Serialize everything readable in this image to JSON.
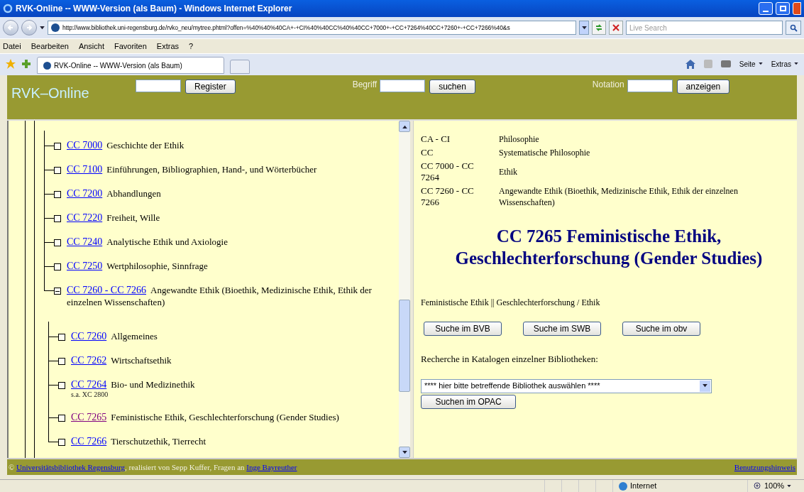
{
  "window": {
    "title": "RVK-Online -- WWW-Version (als Baum) - Windows Internet Explorer"
  },
  "address_bar": {
    "url": "http://www.bibliothek.uni-regensburg.de/rvko_neu/mytree.phtml?offen=%40%40%40CA+-+CI%40%40CC%40%40CC+7000+-+CC+7264%40CC+7260+-+CC+7266%40&s",
    "search_placeholder": "Live Search"
  },
  "menu": [
    "Datei",
    "Bearbeiten",
    "Ansicht",
    "Favoriten",
    "Extras",
    "?"
  ],
  "tabs": [
    {
      "label": "RVK-Online -- WWW-Version (als Baum)",
      "selected": true
    }
  ],
  "toolbar": [
    "Seite",
    "Extras"
  ],
  "header": {
    "logo": "RVK–Online",
    "register_button": "Register",
    "begriff_label": "Begriff",
    "suchen_button": "suchen",
    "notation_label": "Notation",
    "anzeigen_button": "anzeigen"
  },
  "tree": [
    {
      "code": "CC 7000",
      "label": "Geschichte der Ethik",
      "visited": false,
      "expanded": false
    },
    {
      "code": "CC 7100",
      "label": "Einführungen, Bibliographien, Hand-, und Wörterbücher",
      "visited": false,
      "expanded": false
    },
    {
      "code": "CC 7200",
      "label": "Abhandlungen",
      "visited": false,
      "expanded": false
    },
    {
      "code": "CC 7220",
      "label": "Freiheit, Wille",
      "visited": false,
      "expanded": false
    },
    {
      "code": "CC 7240",
      "label": "Analytische Ethik und Axiologie",
      "visited": false,
      "expanded": false
    },
    {
      "code": "CC 7250",
      "label": "Wertphilosophie, Sinnfrage",
      "visited": false,
      "expanded": false
    },
    {
      "code": "CC 7260 - CC 7266",
      "label": "Angewandte Ethik (Bioethik, Medizinische Ethik, Ethik der einzelnen Wissenschaften)",
      "visited": false,
      "expanded": true,
      "children": [
        {
          "code": "CC 7260",
          "label": "Allgemeines",
          "visited": false,
          "expanded": false
        },
        {
          "code": "CC 7262",
          "label": "Wirtschaftsethik",
          "visited": false,
          "expanded": false
        },
        {
          "code": "CC 7264",
          "label": "Bio- und Medizinethik",
          "note": "s.a. XC 2800",
          "visited": false,
          "expanded": false
        },
        {
          "code": "CC 7265",
          "label": "Feministische Ethik, Geschlechterforschung (Gender Studies)",
          "visited": true,
          "expanded": false
        },
        {
          "code": "CC 7266",
          "label": "Tierschutzethik, Tierrecht",
          "visited": false,
          "expanded": false
        }
      ]
    }
  ],
  "breadcrumb": [
    {
      "notation": "CA - CI",
      "label": "Philosophie"
    },
    {
      "notation": "CC",
      "label": "Systematische Philosophie"
    },
    {
      "notation": "CC 7000 - CC 7264",
      "label": "Ethik"
    },
    {
      "notation": "CC 7260 - CC 7266",
      "label": "Angewandte Ethik (Bioethik, Medizinische Ethik, Ethik der einzelnen Wissenschaften)"
    }
  ],
  "heading": "CC 7265 Feministische Ethik, Geschlechterforschung (Gender Studies)",
  "keywords": "Feministische Ethik || Geschlechterforschung / Ethik",
  "search_buttons": [
    "Suche im BVB",
    "Suche im SWB",
    "Suche im obv"
  ],
  "library_label": "Recherche in Katalogen einzelner Bibliotheken:",
  "library_select": "**** hier bitte betreffende Bibliothek auswählen ****",
  "opac_button": "Suchen im OPAC",
  "footer": {
    "copyright": "©",
    "library_link": "Universitätsbibliothek Regensburg",
    "text": ", realisiert von Sepp Kuffer, Fragen an",
    "contact_link": "Inge Bayreuther",
    "help_link": "Benutzungshinweis"
  },
  "status_bar": {
    "zone": "Internet",
    "zoom": "100%"
  }
}
